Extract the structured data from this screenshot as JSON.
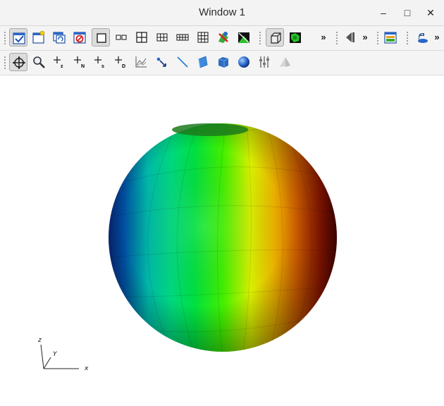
{
  "window": {
    "title": "Window 1"
  },
  "window_controls": {
    "minimize": "–",
    "maximize": "□",
    "close": "✕"
  },
  "toolbar1": {
    "overflow_1": "»",
    "overflow_2": "»",
    "overflow_3": "»",
    "buttons": [
      "select-tool-icon",
      "new-view-icon",
      "refresh-view-icon",
      "stop-view-icon",
      "single-view-layout-icon",
      "two-view-layout-icon",
      "four-view-layout-icon",
      "six-view-layout-icon",
      "eight-view-layout-icon",
      "nine-view-layout-icon",
      "lock-view-icon",
      "image-icon",
      "box-outline-icon",
      "render-mode-icon",
      "animation-back-icon",
      "colormap-icon",
      "python-icon"
    ]
  },
  "toolbar2": {
    "buttons": [
      {
        "icon": "navigate-icon",
        "label": ""
      },
      {
        "icon": "zoom-icon",
        "label": ""
      },
      {
        "icon": "zone-pick-icon",
        "label": "z"
      },
      {
        "icon": "node-pick-icon",
        "label": "N"
      },
      {
        "icon": "spreadsheet-pick-icon",
        "label": "s"
      },
      {
        "icon": "domain-pick-icon",
        "label": "D"
      },
      {
        "icon": "lineout-icon",
        "label": ""
      },
      {
        "icon": "point-tool-icon",
        "label": ""
      },
      {
        "icon": "line-tool-icon",
        "label": ""
      },
      {
        "icon": "plane-tool-icon",
        "label": ""
      },
      {
        "icon": "box-tool-icon",
        "label": ""
      },
      {
        "icon": "sphere-tool-icon",
        "label": ""
      },
      {
        "icon": "axis-restriction-tool-icon",
        "label": ""
      },
      {
        "icon": "extents-tool-icon",
        "label": ""
      }
    ]
  },
  "viewport": {
    "axes": {
      "x": "x",
      "y": "Y",
      "z": "z"
    }
  }
}
